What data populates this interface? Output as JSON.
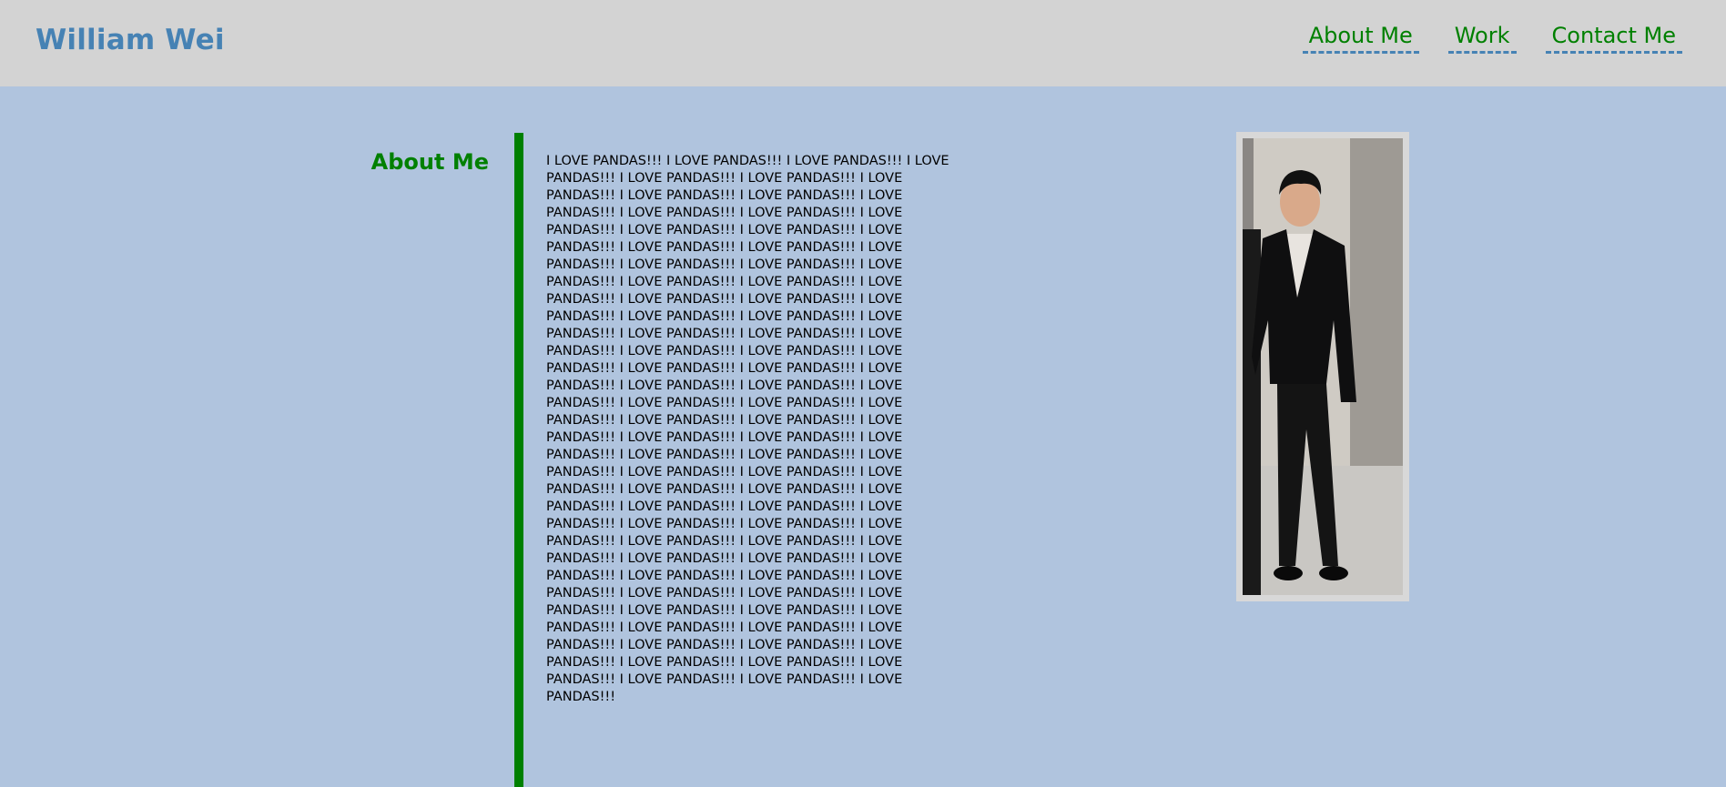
{
  "header": {
    "title": "William Wei",
    "nav": [
      {
        "label": "About Me"
      },
      {
        "label": "Work"
      },
      {
        "label": "Contact Me"
      }
    ]
  },
  "about": {
    "heading": "About Me",
    "body": "I LOVE PANDAS!!! I LOVE PANDAS!!! I LOVE PANDAS!!! I LOVE PANDAS!!! I LOVE PANDAS!!! I LOVE PANDAS!!! I LOVE PANDAS!!! I LOVE PANDAS!!! I LOVE PANDAS!!! I LOVE PANDAS!!! I LOVE PANDAS!!! I LOVE PANDAS!!! I LOVE PANDAS!!! I LOVE PANDAS!!! I LOVE PANDAS!!! I LOVE PANDAS!!! I LOVE PANDAS!!! I LOVE PANDAS!!! I LOVE PANDAS!!! I LOVE PANDAS!!! I LOVE PANDAS!!! I LOVE PANDAS!!! I LOVE PANDAS!!! I LOVE PANDAS!!! I LOVE PANDAS!!! I LOVE PANDAS!!! I LOVE PANDAS!!! I LOVE PANDAS!!! I LOVE PANDAS!!! I LOVE PANDAS!!! I LOVE PANDAS!!! I LOVE PANDAS!!! I LOVE PANDAS!!! I LOVE PANDAS!!! I LOVE PANDAS!!! I LOVE PANDAS!!! I LOVE PANDAS!!! I LOVE PANDAS!!! I LOVE PANDAS!!! I LOVE PANDAS!!! I LOVE PANDAS!!! I LOVE PANDAS!!! I LOVE PANDAS!!! I LOVE PANDAS!!! I LOVE PANDAS!!! I LOVE PANDAS!!! I LOVE PANDAS!!! I LOVE PANDAS!!! I LOVE PANDAS!!! I LOVE PANDAS!!! I LOVE PANDAS!!! I LOVE PANDAS!!! I LOVE PANDAS!!! I LOVE PANDAS!!! I LOVE PANDAS!!! I LOVE PANDAS!!! I LOVE PANDAS!!! I LOVE PANDAS!!! I LOVE PANDAS!!! I LOVE PANDAS!!! I LOVE PANDAS!!! I LOVE PANDAS!!! I LOVE PANDAS!!! I LOVE PANDAS!!! I LOVE PANDAS!!! I LOVE PANDAS!!! I LOVE PANDAS!!! I LOVE PANDAS!!! I LOVE PANDAS!!! I LOVE PANDAS!!! I LOVE PANDAS!!! I LOVE PANDAS!!! I LOVE PANDAS!!! I LOVE PANDAS!!! I LOVE PANDAS!!! I LOVE PANDAS!!! I LOVE PANDAS!!! I LOVE PANDAS!!! I LOVE PANDAS!!! I LOVE PANDAS!!! I LOVE PANDAS!!! I LOVE PANDAS!!! I LOVE PANDAS!!! I LOVE PANDAS!!! I LOVE PANDAS!!! I LOVE PANDAS!!! I LOVE PANDAS!!! I LOVE PANDAS!!! I LOVE PANDAS!!! I LOVE PANDAS!!! I LOVE PANDAS!!! I LOVE PANDAS!!! I LOVE PANDAS!!! I LOVE PANDAS!!!"
  },
  "colors": {
    "page_background": "#b0c4de",
    "header_background": "#d3d3d3",
    "title": "#4682b4",
    "accent_green": "#008000",
    "nav_underline": "#4682b4"
  }
}
